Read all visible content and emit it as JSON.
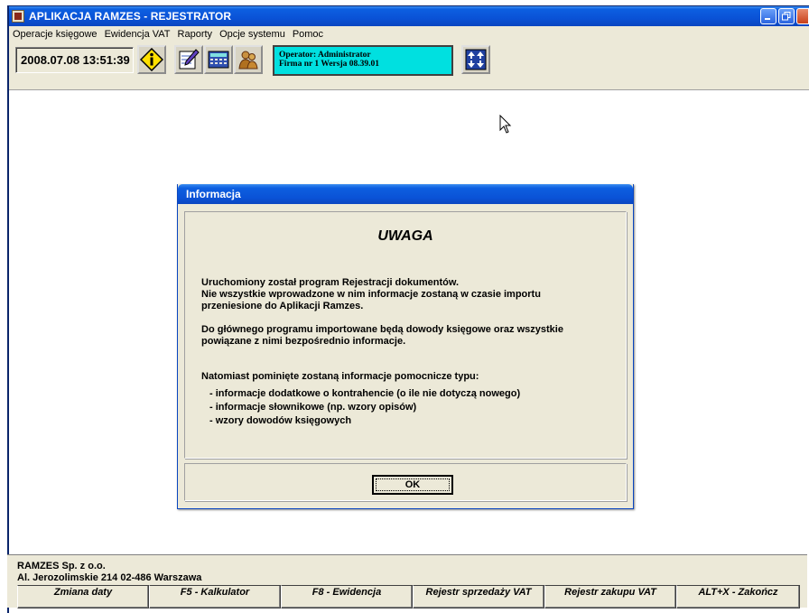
{
  "window": {
    "title": "APLIKACJA RAMZES - REJESTRATOR"
  },
  "menu": [
    "Operacje księgowe",
    "Ewidencja VAT",
    "Raporty",
    "Opcje systemu",
    "Pomoc"
  ],
  "toolbar": {
    "datetime": "2008.07.08 13:51:39",
    "operator_line": "Operator: Administrator",
    "firm_line": "Firma nr 1   Wersja 08.39.01"
  },
  "dialog": {
    "title": "Informacja",
    "heading": "UWAGA",
    "para1": [
      "Uruchomiony został program Rejestracji dokumentów.",
      "Nie wszystkie wprowadzone w nim informacje zostaną w czasie importu",
      "przeniesione do Aplikacji Ramzes."
    ],
    "para2": [
      "Do głównego programu importowane będą dowody księgowe oraz wszystkie",
      "powiązane z nimi bezpośrednio informacje."
    ],
    "para3": "Natomiast pominięte zostaną informacje pomocnicze typu:",
    "bullets": [
      "- informacje dodatkowe o kontrahencie (o ile nie dotyczą nowego)",
      "- informacje słownikowe (np. wzory opisów)",
      "- wzory dowodów księgowych"
    ],
    "ok_label": "OK"
  },
  "status": {
    "company_name": "RAMZES Sp. z o.o.",
    "company_address": "Al. Jerozolimskie 214  02-486 Warszawa",
    "fkeys": [
      "Zmiana daty",
      "F5 - Kalkulator",
      "F8 -  Ewidencja",
      "Rejestr sprzedaży VAT",
      "Rejestr zakupu VAT",
      "ALT+X - Zakończ"
    ]
  },
  "colors": {
    "titlebar": "#0a52d6",
    "operator_bg": "#00e0e0",
    "face": "#ece9d8"
  }
}
